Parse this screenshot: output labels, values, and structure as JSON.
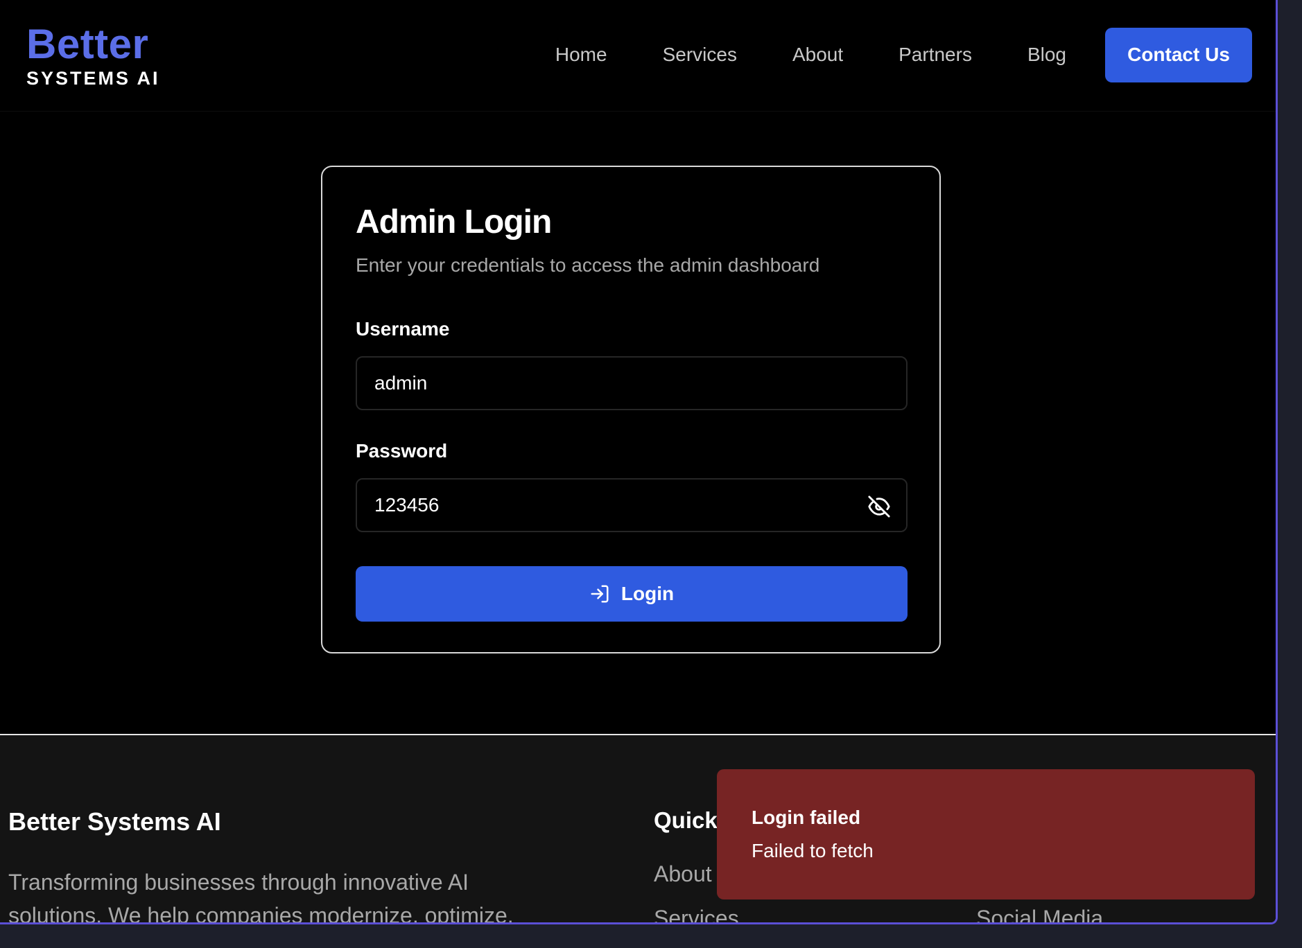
{
  "brand": {
    "logo_top": "Better",
    "logo_bottom": "SYSTEMS AI"
  },
  "nav": {
    "items": [
      {
        "label": "Home"
      },
      {
        "label": "Services"
      },
      {
        "label": "About"
      },
      {
        "label": "Partners"
      },
      {
        "label": "Blog"
      }
    ],
    "cta_label": "Contact Us"
  },
  "login": {
    "title": "Admin Login",
    "subtitle": "Enter your credentials to access the admin dashboard",
    "username_label": "Username",
    "username_value": "admin",
    "password_label": "Password",
    "password_value": "123456",
    "password_toggle_icon": "eye-off-icon",
    "submit_icon": "log-in-icon",
    "submit_label": "Login"
  },
  "footer": {
    "brand": "Better Systems AI",
    "description": "Transforming businesses through innovative AI solutions. We help companies modernize, optimize,",
    "quick_links_title": "Quick",
    "links": [
      {
        "label": "About"
      },
      {
        "label": "Services"
      }
    ],
    "social_label": "Social Media"
  },
  "toast": {
    "title": "Login failed",
    "message": "Failed to fetch"
  },
  "colors": {
    "accent": "#2f5be0",
    "logo": "#5b6ee8",
    "toast_bg": "#772424",
    "frame": "#5b4fd6"
  }
}
